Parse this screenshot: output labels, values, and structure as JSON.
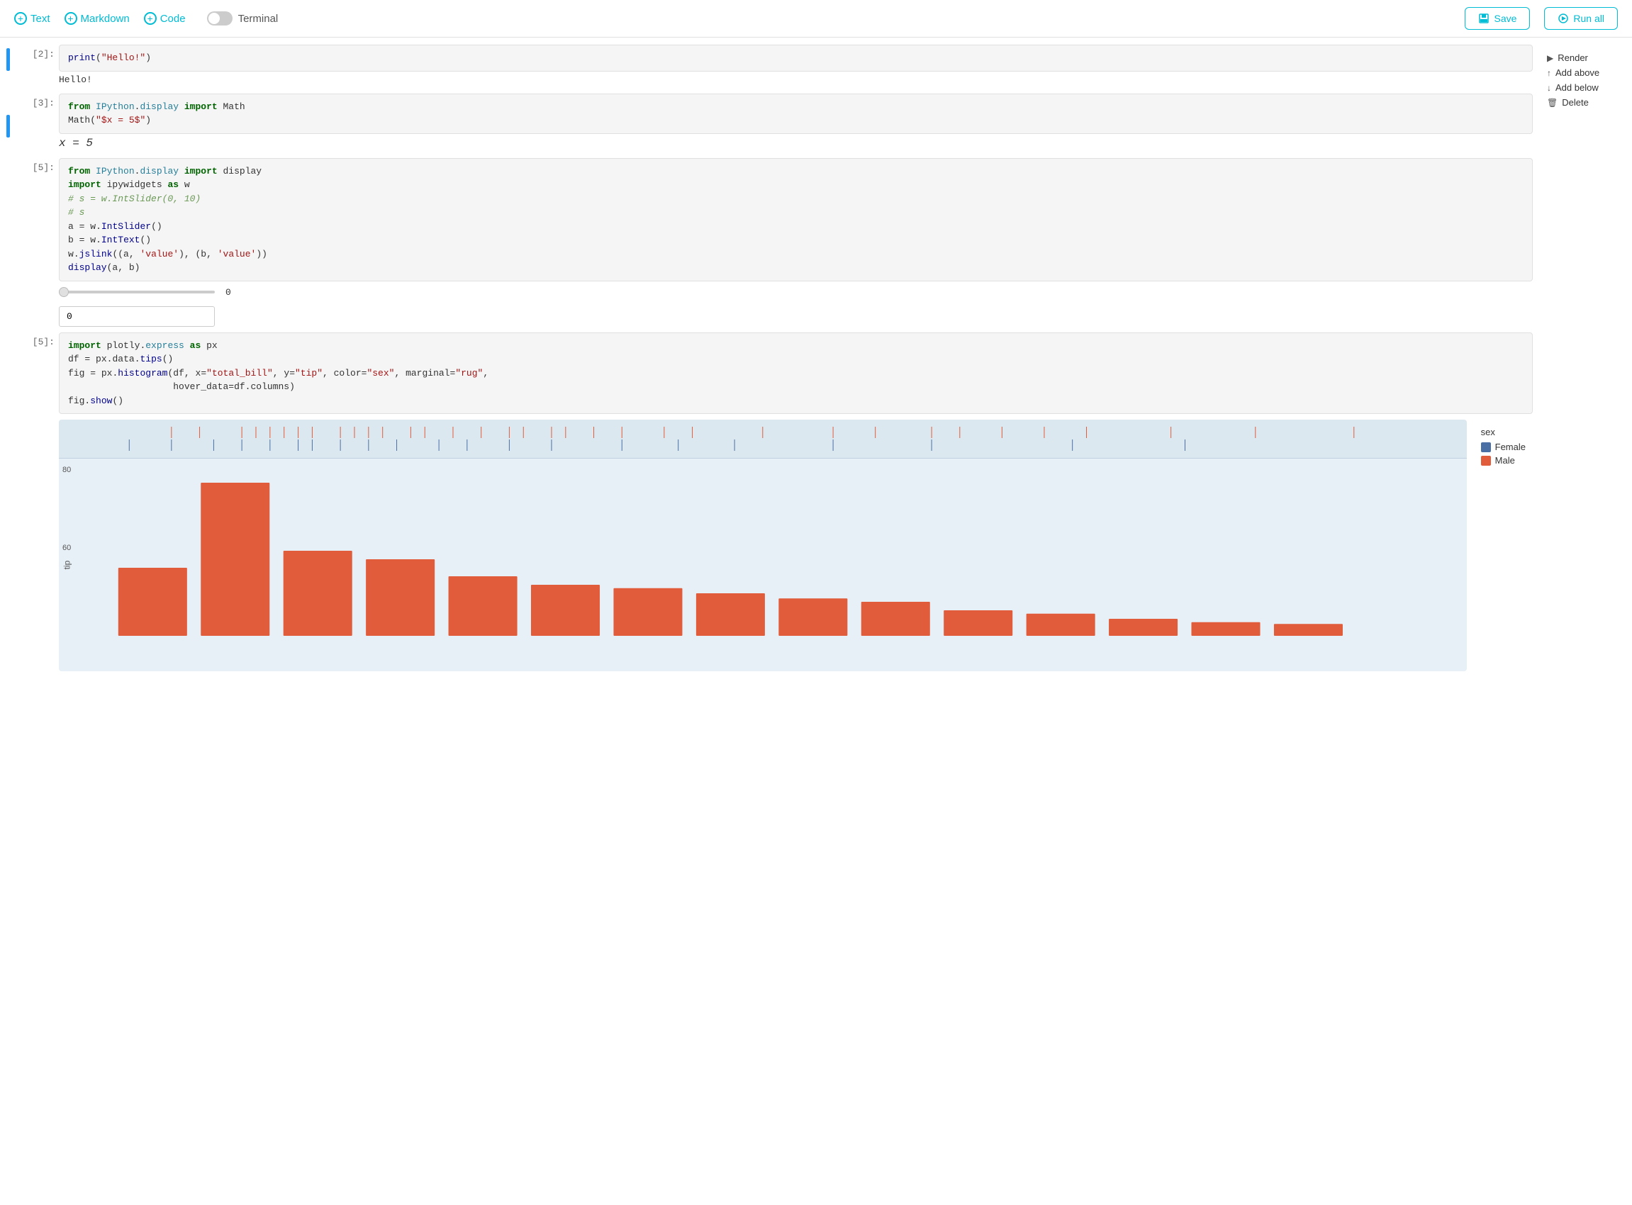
{
  "toolbar": {
    "text_label": "Text",
    "markdown_label": "Markdown",
    "code_label": "Code",
    "terminal_label": "Terminal",
    "save_label": "Save",
    "run_all_label": "Run all"
  },
  "right_panel": {
    "render_label": "Render",
    "add_above_label": "Add above",
    "add_below_label": "Add below",
    "delete_label": "Delete"
  },
  "cells": [
    {
      "id": "cell1",
      "label": "[2]:",
      "code": "print(\"Hello!\")",
      "output": "Hello!"
    },
    {
      "id": "cell2",
      "label": "[3]:",
      "code_line1": "from IPython.display import Math",
      "code_line2": "Math(\"$x = 5$\")",
      "output_math": "x = 5"
    },
    {
      "id": "cell3",
      "label": "[5]:",
      "code_lines": [
        "from IPython.display import display",
        "import ipywidgets as w",
        "# s = w.IntSlider(0, 10)",
        "# s",
        "a = w.IntSlider()",
        "b = w.IntText()",
        "w.jslink((a, 'value'), (b, 'value'))",
        "display(a, b)"
      ],
      "slider_value": "0",
      "int_text_value": "0"
    },
    {
      "id": "cell4",
      "label": "[5]:",
      "code_lines": [
        "import plotly.express as px",
        "df = px.data.tips()",
        "fig = px.histogram(df, x=\"total_bill\", y=\"tip\", color=\"sex\", marginal=\"rug\",",
        "                   hover_data=df.columns)",
        "fig.show()"
      ]
    }
  ],
  "chart": {
    "legend_title": "sex",
    "legend_female": "Female",
    "legend_male": "Male",
    "y_axis_label": "tip",
    "y_labels": [
      "80",
      "60"
    ],
    "female_color": "#4a6fa5",
    "male_color": "#e05c3a"
  }
}
